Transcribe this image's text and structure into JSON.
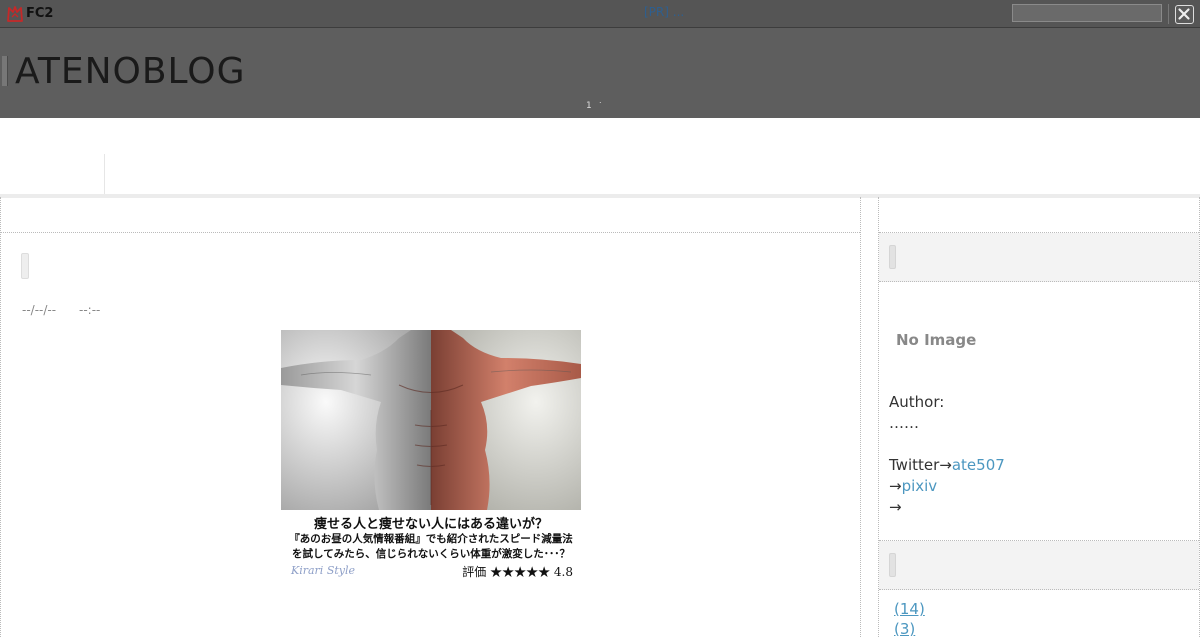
{
  "fc2bar": {
    "logo_text": "FC2",
    "pr_text": "[PR] ...",
    "search_placeholder": "",
    "close_icon": "close-icon"
  },
  "header": {
    "blog_title": "ATENOBLOG",
    "page_number": "1",
    "dot": "."
  },
  "post": {
    "date": "--/--/--",
    "time": "--:--",
    "ad": {
      "headline": "痩せる人と痩せない人にはある違いが？",
      "line2": "『あのお昼の人気情報番組』でも紹介されたスピード減量法",
      "line3": "を試してみたら、信じられないくらい体重が激変した･･･？",
      "brand": "Kirari Style",
      "rating": "評価 ★★★★★ 4.8"
    }
  },
  "sidebar": {
    "no_image": "No Image",
    "author_label": "Author:",
    "author_name": "……",
    "twitter_label": "Twitter→",
    "twitter_handle": "ate507",
    "pixiv_arrow": "→",
    "pixiv_link": "pixiv",
    "extra_arrow": "→",
    "categories": [
      {
        "count": "(14)"
      },
      {
        "count": "(3)"
      }
    ]
  }
}
